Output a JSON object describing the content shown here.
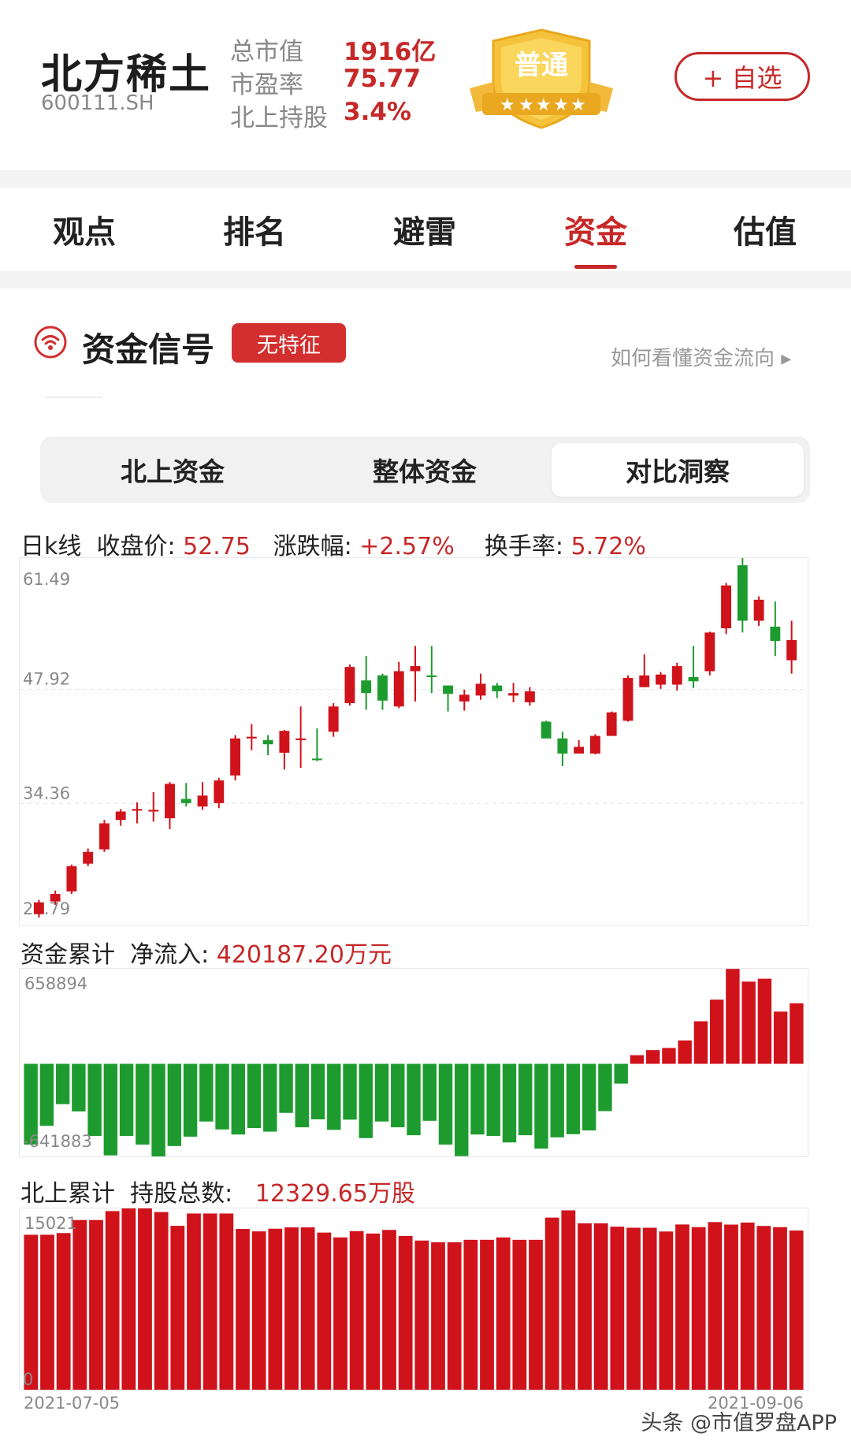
{
  "header": {
    "name": "北方稀土",
    "code": "600111.SH",
    "metrics": [
      {
        "label": "总市值",
        "value": "1916亿"
      },
      {
        "label": "市盈率",
        "value": "75.77"
      },
      {
        "label": "北上持股",
        "value": "3.4%"
      }
    ],
    "badge_text": "普通",
    "badge_stars": 5,
    "follow_label": "+ 自选"
  },
  "tabs": [
    {
      "label": "观点",
      "active": false
    },
    {
      "label": "排名",
      "active": false
    },
    {
      "label": "避雷",
      "active": false
    },
    {
      "label": "资金",
      "active": true
    },
    {
      "label": "估值",
      "active": false
    }
  ],
  "signal": {
    "title": "资金信号",
    "badge": "无特征",
    "help_link": "如何看懂资金流向 ▸"
  },
  "segments": [
    {
      "label": "北上资金",
      "active": false
    },
    {
      "label": "整体资金",
      "active": false
    },
    {
      "label": "对比洞察",
      "active": true
    }
  ],
  "kline_stats": {
    "prefix": "日k线",
    "close_label": "收盘价:",
    "close_value": "52.75",
    "change_label": "涨跌幅:",
    "change_value": "+2.57%",
    "turnover_label": "换手率:",
    "turnover_value": "5.72%"
  },
  "flow_stats": {
    "prefix": "资金累计",
    "label": "净流入:",
    "value": "420187.20万元"
  },
  "hold_stats": {
    "prefix": "北上累计",
    "label": "持股总数:",
    "value": "12329.65万股"
  },
  "colors": {
    "up": "#d0121b",
    "down": "#1e9b2e",
    "accent": "#c62828"
  },
  "watermark": "头条 @市值罗盘APP",
  "chart_data": [
    {
      "type": "candlestick",
      "title": "日k线",
      "y_ticks": [
        "61.49",
        "47.92",
        "34.36",
        "20.79"
      ],
      "ylim": [
        20.79,
        61.49
      ],
      "candles": [
        [
          21.2,
          22.6,
          20.8,
          22.9
        ],
        [
          22.7,
          23.6,
          22.3,
          24.0
        ],
        [
          23.9,
          26.9,
          23.6,
          27.1
        ],
        [
          27.2,
          28.6,
          26.9,
          29.0
        ],
        [
          28.9,
          32.0,
          28.6,
          32.4
        ],
        [
          32.4,
          33.4,
          31.7,
          33.7
        ],
        [
          33.5,
          33.7,
          32.0,
          34.5
        ],
        [
          33.4,
          33.6,
          32.2,
          35.7
        ],
        [
          32.6,
          36.7,
          31.3,
          36.9
        ],
        [
          34.9,
          34.4,
          34.0,
          36.8
        ],
        [
          34.0,
          35.3,
          33.6,
          36.9
        ],
        [
          34.4,
          37.1,
          33.8,
          37.4
        ],
        [
          37.7,
          42.1,
          37.1,
          42.5
        ],
        [
          42.1,
          42.3,
          40.7,
          43.8
        ],
        [
          41.9,
          41.4,
          40.1,
          42.5
        ],
        [
          40.4,
          43.0,
          38.4,
          43.1
        ],
        [
          41.9,
          42.1,
          38.6,
          45.9
        ],
        [
          39.7,
          39.6,
          39.4,
          43.3
        ],
        [
          42.9,
          45.9,
          42.3,
          46.3
        ],
        [
          46.3,
          50.6,
          46.0,
          50.9
        ],
        [
          49.0,
          47.5,
          45.5,
          51.9
        ],
        [
          49.6,
          46.6,
          45.5,
          49.8
        ],
        [
          45.9,
          50.1,
          45.7,
          51.2
        ],
        [
          50.1,
          50.7,
          46.5,
          53.1
        ],
        [
          49.6,
          49.4,
          47.5,
          53.1
        ],
        [
          48.4,
          47.4,
          45.3,
          48.4
        ],
        [
          46.5,
          47.3,
          45.4,
          47.9
        ],
        [
          47.2,
          48.6,
          46.7,
          49.8
        ],
        [
          48.4,
          47.7,
          46.9,
          48.7
        ],
        [
          47.2,
          47.5,
          46.4,
          48.7
        ],
        [
          46.4,
          47.7,
          46.0,
          48.2
        ],
        [
          44.1,
          42.1,
          42.1,
          44.2
        ],
        [
          42.1,
          40.3,
          38.8,
          42.9
        ],
        [
          40.3,
          41.1,
          40.3,
          41.9
        ],
        [
          40.3,
          42.4,
          40.2,
          42.6
        ],
        [
          42.4,
          45.2,
          42.4,
          45.3
        ],
        [
          44.2,
          49.3,
          44.1,
          49.6
        ],
        [
          48.2,
          49.6,
          48.2,
          52.1
        ],
        [
          48.5,
          49.7,
          48.0,
          50.0
        ],
        [
          48.5,
          50.7,
          47.8,
          51.1
        ],
        [
          49.4,
          48.9,
          48.1,
          53.1
        ],
        [
          50.1,
          54.7,
          49.6,
          54.8
        ],
        [
          55.2,
          60.3,
          54.5,
          60.6
        ],
        [
          62.7,
          56.1,
          54.7,
          64.6
        ],
        [
          56.1,
          58.6,
          55.5,
          59.0
        ],
        [
          55.4,
          53.7,
          51.9,
          58.4
        ],
        [
          51.4,
          53.8,
          49.8,
          56.1
        ]
      ]
    },
    {
      "type": "bar",
      "title": "资金累计",
      "y_ticks": [
        "658894",
        "-641883"
      ],
      "ylim": [
        -641883,
        658894
      ],
      "values": [
        -560000,
        -430000,
        -280000,
        -330000,
        -500000,
        -635000,
        -500000,
        -560000,
        -650000,
        -570000,
        -505000,
        -400000,
        -455000,
        -490000,
        -445000,
        -470000,
        -340000,
        -440000,
        -385000,
        -458000,
        -387000,
        -515000,
        -400000,
        -440000,
        -495000,
        -395000,
        -560000,
        -640000,
        -490000,
        -500000,
        -545000,
        -495000,
        -588000,
        -510000,
        -488000,
        -462000,
        -328000,
        -137000,
        60000,
        95000,
        110000,
        162000,
        295000,
        445000,
        658000,
        570000,
        590000,
        362000,
        420000
      ]
    },
    {
      "type": "bar",
      "title": "北上累计",
      "y_ticks": [
        "15021",
        "0"
      ],
      "ylim": [
        0,
        15021
      ],
      "x_labels": [
        "2021-07-05",
        "2021-09-06"
      ],
      "values": [
        12840,
        12840,
        12980,
        14060,
        14060,
        14800,
        15021,
        15021,
        14720,
        13580,
        14600,
        14600,
        14600,
        13320,
        13120,
        13340,
        13450,
        13450,
        13020,
        12620,
        13140,
        12940,
        13240,
        12740,
        12360,
        12220,
        12220,
        12420,
        12420,
        12620,
        12420,
        12420,
        14260,
        14860,
        13790,
        13790,
        13510,
        13420,
        13420,
        13110,
        13690,
        13470,
        13890,
        13680,
        13850,
        13570,
        13470,
        13190
      ]
    }
  ]
}
